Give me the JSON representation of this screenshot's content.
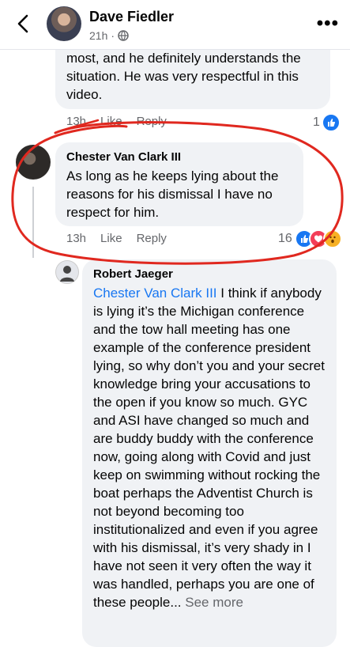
{
  "header": {
    "name": "Dave Fiedler",
    "time": "21h",
    "visibility_icon": "globe-icon",
    "more_label": "•••"
  },
  "comment_top": {
    "text_lines": [
      "most, and he definitely understands the",
      "situation. He was very respectful in this",
      "video."
    ],
    "time": "13h",
    "like": "Like",
    "reply": "Reply",
    "reaction_count": "1",
    "reaction_icons": [
      "like-icon"
    ]
  },
  "comment_chester": {
    "author": "Chester Van Clark III",
    "text": "As long as he keeps lying about the reasons for his dismissal I have no respect for him.",
    "time": "13h",
    "like": "Like",
    "reply": "Reply",
    "reaction_count": "16",
    "reaction_icons": [
      "like-icon",
      "love-icon",
      "wow-icon"
    ]
  },
  "comment_robert": {
    "author": "Robert Jaeger",
    "mention": "Chester Van Clark III",
    "text": " I think if anybody is lying it’s the Michigan conference and the tow hall meeting has one example of the conference president lying, so why don’t you and your secret knowledge bring your accusations to the open if you know so much. GYC and ASI have changed so much and are buddy buddy with the conference now, going along with Covid and just keep on swimming without rocking the boat perhaps the Adventist Church is not beyond becoming too institutionalized and even if you agree with his dismissal, it’s very shady in I have not seen it very often the way it was handled, perhaps you are one of these people...",
    "see_more": "See more"
  },
  "colors": {
    "accent": "#1877f2",
    "annotation": "#e0281f",
    "bubble": "#f0f2f5"
  }
}
